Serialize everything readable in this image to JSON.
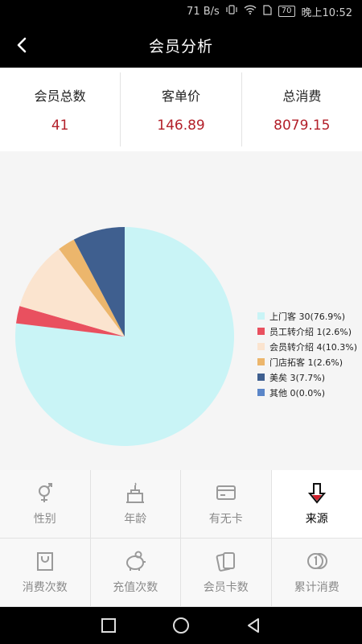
{
  "status_bar": {
    "speed": "71 B/s",
    "battery": "70",
    "time": "晚上10:52"
  },
  "header": {
    "title": "会员分析"
  },
  "summary": [
    {
      "label": "会员总数",
      "value": "41"
    },
    {
      "label": "客单价",
      "value": "146.89"
    },
    {
      "label": "总消费",
      "value": "8079.15"
    }
  ],
  "chart_data": {
    "type": "pie",
    "title": "",
    "slices": [
      {
        "label": "上门客 30(76.9%)",
        "value": 30,
        "color": "#c9f4f6"
      },
      {
        "label": "员工转介绍 1(2.6%)",
        "value": 1,
        "color": "#e9505f"
      },
      {
        "label": "会员转介绍 4(10.3%)",
        "value": 4,
        "color": "#fbe4cf"
      },
      {
        "label": "门店拓客 1(2.6%)",
        "value": 1,
        "color": "#ecb66c"
      },
      {
        "label": "美矣 3(7.7%)",
        "value": 3,
        "color": "#3f5f8f"
      },
      {
        "label": "其他 0(0.0%)",
        "value": 0,
        "color": "#5b86c8"
      }
    ],
    "legend_position": "right"
  },
  "tabs": [
    {
      "label": "性别",
      "icon": "gender-icon",
      "active": false
    },
    {
      "label": "年龄",
      "icon": "cake-icon",
      "active": false
    },
    {
      "label": "有无卡",
      "icon": "card-icon",
      "active": false
    },
    {
      "label": "来源",
      "icon": "source-arrow-icon",
      "active": true
    },
    {
      "label": "消费次数",
      "icon": "bag-icon",
      "active": false
    },
    {
      "label": "充值次数",
      "icon": "piggy-bank-icon",
      "active": false
    },
    {
      "label": "会员卡数",
      "icon": "cards-icon",
      "active": false
    },
    {
      "label": "累计消费",
      "icon": "coins-icon",
      "active": false
    }
  ],
  "colors": {
    "accent": "#b3202a",
    "inactive": "#8a8a8a"
  }
}
